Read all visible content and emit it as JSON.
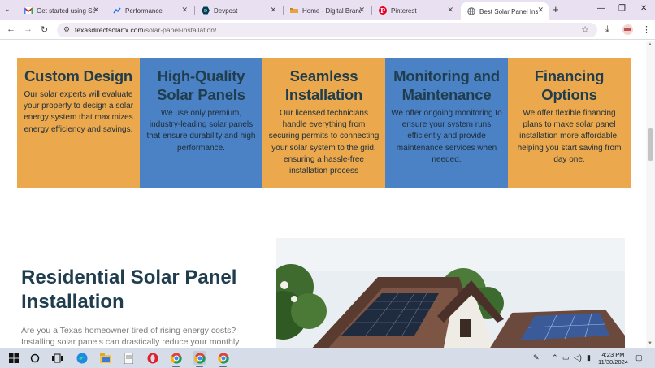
{
  "browser": {
    "tabs": [
      {
        "label": "Get started using Sea",
        "icon": "gmail-icon",
        "color": "#c5221f"
      },
      {
        "label": "Performance",
        "icon": "performance-icon",
        "color": "#1a73e8"
      },
      {
        "label": "Devpost",
        "icon": "devpost-icon",
        "color": "#003e54"
      },
      {
        "label": "Home - Digital Brand",
        "icon": "folder-icon",
        "color": "#e8a33d"
      },
      {
        "label": "Pinterest",
        "icon": "pinterest-icon",
        "color": "#e60023"
      },
      {
        "label": "Best Solar Panel Insta",
        "icon": "globe-icon",
        "color": "#5f6368",
        "active": true
      }
    ],
    "url_prefix": "texasdirectsolartx.com",
    "url_path": "/solar-panel-installation/"
  },
  "features": [
    {
      "title": "Custom Design",
      "text": "Our solar experts will evaluate your property to design a solar energy system that maximizes energy efficiency and savings.",
      "color": "#eba84d"
    },
    {
      "title": "High-Quality Solar Panels",
      "text": "We use only premium, industry-leading solar panels that ensure durability and high performance.",
      "color": "#4b82c5"
    },
    {
      "title": "Seamless Installation",
      "text": "Our licensed technicians handle everything from securing permits to connecting your solar system to the grid, ensuring a hassle-free installation process",
      "color": "#eba84d"
    },
    {
      "title": "Monitoring and Maintenance",
      "text": "We offer ongoing monitoring to ensure your system runs efficiently and provide maintenance services when needed.",
      "color": "#4b82c5"
    },
    {
      "title": "Financing Options",
      "text": "We offer flexible financing plans to make solar panel installation more affordable, helping you start saving from day one.",
      "color": "#eba84d"
    }
  ],
  "residential": {
    "title": "Residential Solar Panel Installation",
    "text": "Are you a Texas homeowner tired of rising energy costs? Installing solar panels can drastically reduce your monthly electricity bill and"
  },
  "taskbar": {
    "time": "4:23 PM",
    "date": "11/30/2024"
  }
}
